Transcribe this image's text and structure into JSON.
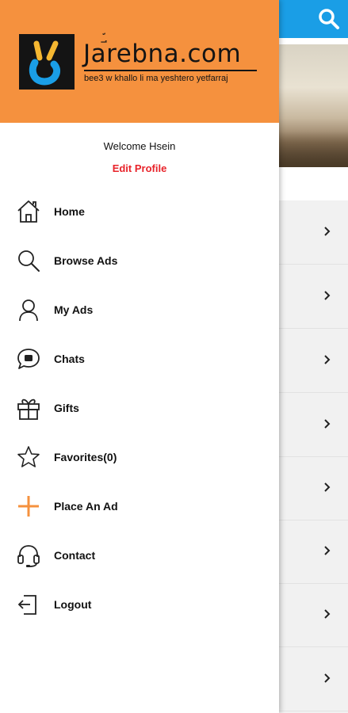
{
  "brand": {
    "name_part1": "J",
    "name_part2": "arebna.com",
    "name_accent": "؀ّ",
    "tagline": "bee3 w khallo li ma yeshtero yetfarraj",
    "header_color": "#f5913e"
  },
  "user": {
    "welcome": "Welcome Hsein",
    "edit_profile": "Edit Profile",
    "edit_color": "#e8232a"
  },
  "menu": {
    "items": [
      {
        "label": "Home",
        "icon": "home-icon"
      },
      {
        "label": "Browse Ads",
        "icon": "search-icon"
      },
      {
        "label": "My Ads",
        "icon": "user-icon"
      },
      {
        "label": "Chats",
        "icon": "chat-icon"
      },
      {
        "label": "Gifts",
        "icon": "gift-icon"
      },
      {
        "label": "Favorites(0)",
        "icon": "star-icon"
      },
      {
        "label": "Place An Ad",
        "icon": "plus-icon"
      },
      {
        "label": "Contact",
        "icon": "headset-icon"
      },
      {
        "label": "Logout",
        "icon": "logout-icon"
      }
    ]
  },
  "background": {
    "topbar_color": "#1a9ee6",
    "search_icon": "search-icon",
    "row_icon": "chevron-right-icon"
  }
}
